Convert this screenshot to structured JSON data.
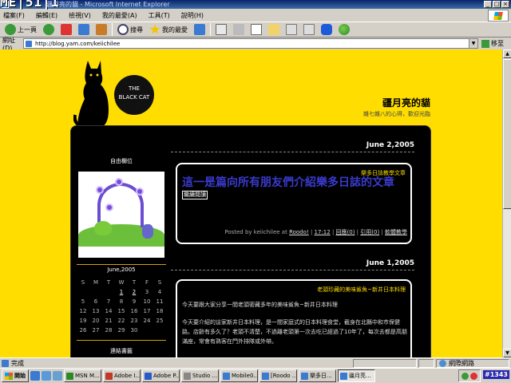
{
  "window": {
    "overlay_text": "ME|51|1",
    "title": "疆月亮的貓 - Microsoft Internet Explorer"
  },
  "menu": [
    "檔案(F)",
    "編輯(E)",
    "檢視(V)",
    "我的最愛(A)",
    "工具(T)",
    "說明(H)"
  ],
  "toolbar": {
    "back_label": "上一頁",
    "search_label": "搜尋",
    "favorites_label": "我的最愛"
  },
  "address": {
    "label": "網址(D)",
    "url": "http://blog.yam.com/keiichilee",
    "go_label": "移至"
  },
  "blog": {
    "cat_badge_line1": "THE",
    "cat_badge_line2": "BLACK CAT",
    "title": "疆月亮的貓",
    "description": "雜七雜八的心得，歡迎光臨"
  },
  "sidebar": {
    "free_slot_heading": "自由欄位",
    "calendar_title": "June,2005",
    "weekdays": [
      "S",
      "M",
      "T",
      "W",
      "T",
      "F",
      "S"
    ],
    "weeks": [
      [
        "",
        "",
        "",
        "1",
        "2",
        "3",
        "4"
      ],
      [
        "5",
        "6",
        "7",
        "8",
        "9",
        "10",
        "11"
      ],
      [
        "12",
        "13",
        "14",
        "15",
        "16",
        "17",
        "18"
      ],
      [
        "19",
        "20",
        "21",
        "22",
        "23",
        "24",
        "25"
      ],
      [
        "26",
        "27",
        "28",
        "29",
        "30",
        "",
        ""
      ]
    ],
    "underlined_days": [
      "1",
      "2"
    ],
    "links_heading": "連結書籤"
  },
  "posts": [
    {
      "date": "June 2,2005",
      "category": "樂多日誌教學文章",
      "title": "這一是篇向所有朋友們介紹樂多日誌的文章",
      "link_box": "繼續閱讀",
      "footer": {
        "posted_by": "Posted by keiichilee at",
        "author_link": "Roodo!",
        "time": "17:12",
        "comments": "回應(0)",
        "trackbacks": "引用(0)",
        "category_link": "軟體教學"
      }
    },
    {
      "date": "June 1,2005",
      "category": "老頭珍藏的美味鯊魚~新井日本料理",
      "body_line1": "今天要跟大家分享一間老頭密藏多年的美味鯊魚~新井日本料理",
      "body_line2": "今天要介紹的這家新井日本料理，是一間家庭式的日本料理食堂，截身在北縣中和市保健路。店齡有多久了？老頭不清楚，不過離老頭第一次去吃已經過了10年了，每次去都是高朋滿座，常會有熟客在門外排隊或外帶。"
    }
  ],
  "status": {
    "text": "完成",
    "zone": "網際網路"
  },
  "taskbar": {
    "start_label": "開始",
    "tasks": [
      "MSN M...",
      "Adobe I...",
      "Adobe P...",
      "Studio ...",
      "Mobile0...",
      "[Roodo ...",
      "樂多日...",
      "疆月亮..."
    ],
    "active_index": 7,
    "clock": "#1343"
  },
  "colors": {
    "page_background": "#ffdd00",
    "panel": "#000000",
    "post_title": "#3a3acc",
    "category_text": "#ffdd00"
  }
}
